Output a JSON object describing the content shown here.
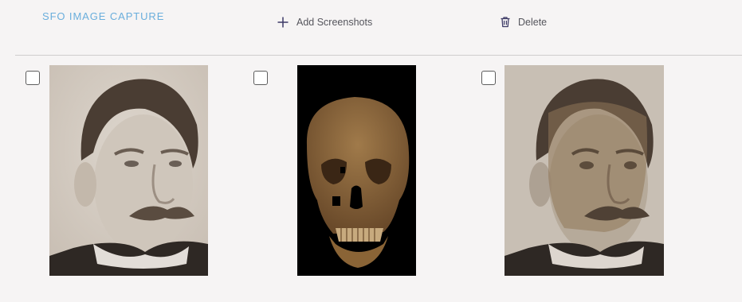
{
  "app": {
    "title": "SFO IMAGE CAPTURE"
  },
  "toolbar": {
    "add_label": "Add Screenshots",
    "add_icon": "plus-icon",
    "delete_label": "Delete",
    "delete_icon": "trash-icon"
  },
  "gallery": {
    "items": [
      {
        "kind": "portrait-photo",
        "checked": false
      },
      {
        "kind": "skull-scan",
        "checked": false
      },
      {
        "kind": "overlay-composite",
        "checked": false
      }
    ]
  },
  "colors": {
    "title": "#6aaedc",
    "background": "#f6f4f4",
    "toolbar_text": "#55555c",
    "icon": "#3d3a66"
  }
}
